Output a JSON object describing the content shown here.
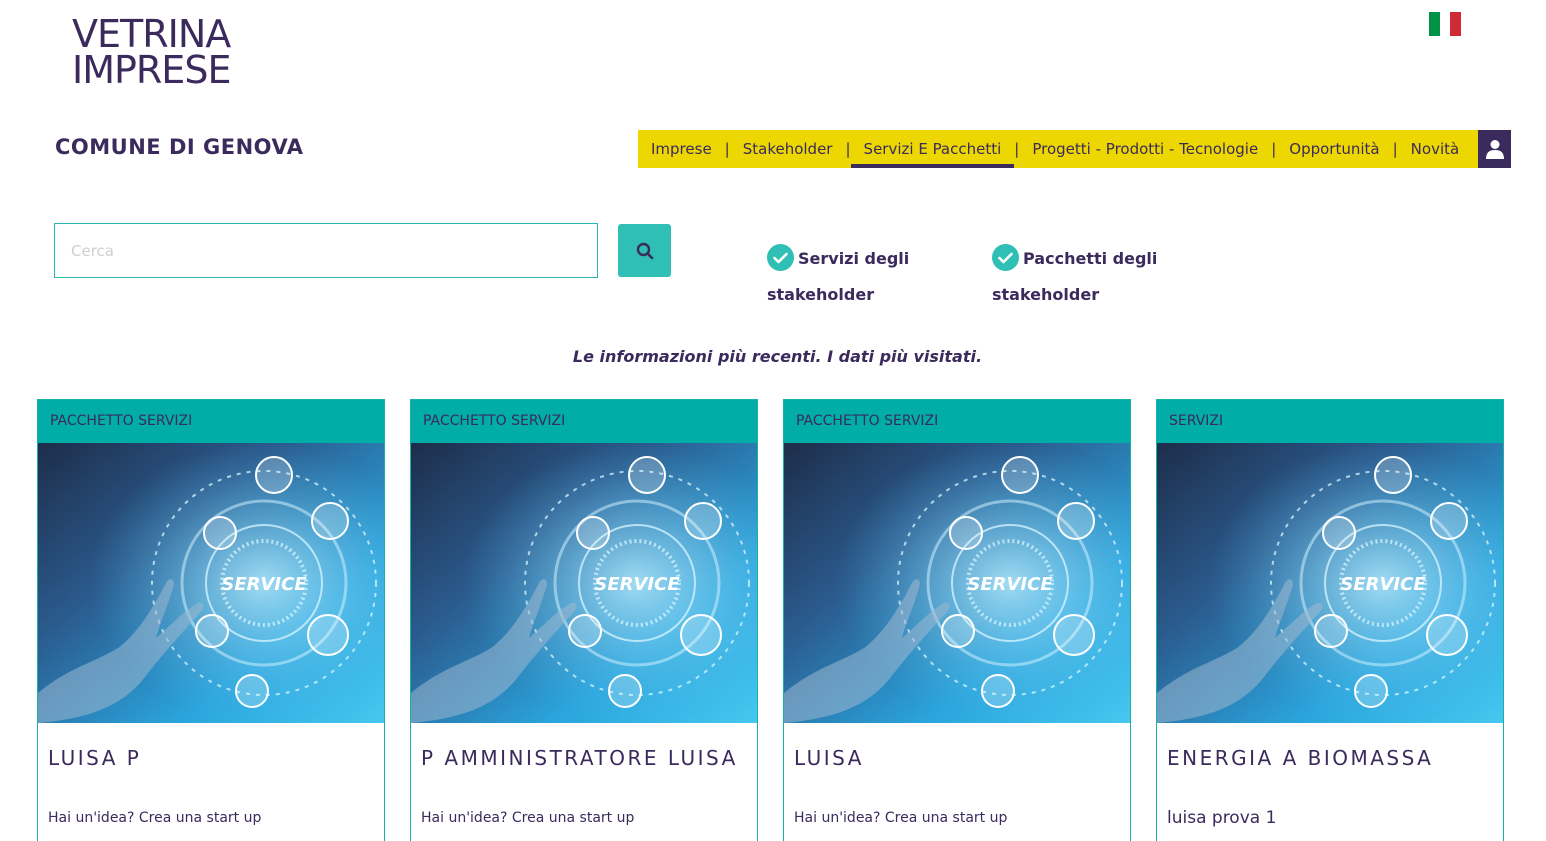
{
  "logo": {
    "line1": "VETRINA",
    "line2": "IMPRESE"
  },
  "language_flag": {
    "icon": "italian-flag-icon",
    "colors": [
      "#009246",
      "#ffffff",
      "#ce2b37"
    ]
  },
  "org_title": "COMUNE DI GENOVA",
  "nav": {
    "items": [
      {
        "label": "Imprese"
      },
      {
        "label": "Stakeholder"
      },
      {
        "label": "Servizi E Pacchetti",
        "active": true
      },
      {
        "label": "Progetti - Prodotti - Tecnologie"
      },
      {
        "label": "Opportunità"
      },
      {
        "label": "Novità"
      }
    ],
    "separator": "|",
    "user_icon": "user-icon"
  },
  "search": {
    "placeholder": "Cerca",
    "value": "",
    "icon": "search-icon"
  },
  "filters": [
    {
      "label": "Servizi degli stakeholder",
      "checked": true,
      "icon": "check-circle-icon"
    },
    {
      "label": "Pacchetti degli stakeholder",
      "checked": true,
      "icon": "check-circle-icon"
    }
  ],
  "tagline": "Le informazioni più recenti. I dati più visitati.",
  "cards": [
    {
      "category": "PACCHETTO SERVIZI",
      "title": "LUISA P",
      "description": "Hai un'idea? Crea una start up",
      "image_text": "SERVICE"
    },
    {
      "category": "PACCHETTO SERVIZI",
      "title": "P AMMINISTRATORE LUISA",
      "description": "Hai un'idea? Crea una start up",
      "image_text": "SERVICE"
    },
    {
      "category": "PACCHETTO SERVIZI",
      "title": "LUISA",
      "description": "Hai un'idea? Crea una start up",
      "image_text": "SERVICE"
    },
    {
      "category": "SERVIZI",
      "title": "ENERGIA A BIOMASSA",
      "description": "luisa prova 1",
      "image_text": "SERVICE"
    }
  ],
  "colors": {
    "brand_purple": "#3b2a5c",
    "nav_yellow": "#ecd800",
    "teal": "#2fbfb4",
    "card_header_teal": "#00aea7"
  }
}
